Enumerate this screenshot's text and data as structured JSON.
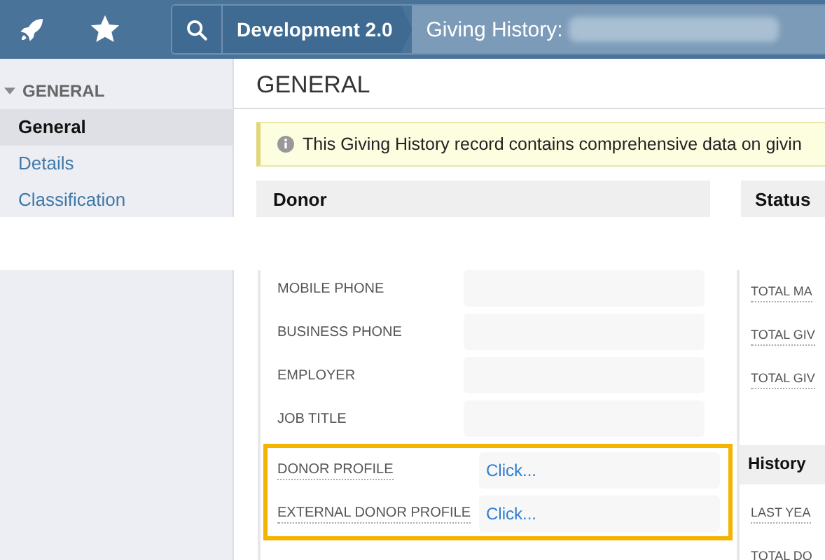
{
  "top_bar": {
    "breadcrumbs": [
      {
        "label": "Development 2.0"
      },
      {
        "label": "Giving History:",
        "redacted_suffix": true
      }
    ]
  },
  "sidebar": {
    "section": {
      "label": "GENERAL",
      "expanded": true
    },
    "items": [
      {
        "label": "General",
        "selected": true
      },
      {
        "label": "Details",
        "selected": false
      },
      {
        "label": "Classification",
        "selected": false
      }
    ]
  },
  "page_title": "GENERAL",
  "info_banner": "This Giving History record contains comprehensive data on givin",
  "donor": {
    "title": "Donor",
    "fields": [
      {
        "label": "MOBILE PHONE",
        "help": false
      },
      {
        "label": "BUSINESS PHONE",
        "help": false
      },
      {
        "label": "EMPLOYER",
        "help": false
      },
      {
        "label": "JOB TITLE",
        "help": false
      }
    ],
    "highlighted_fields": [
      {
        "label": "DONOR PROFILE",
        "help": true,
        "value": "Click..."
      },
      {
        "label": "EXTERNAL DONOR PROFILE",
        "help": true,
        "value": "Click..."
      }
    ]
  },
  "status": {
    "title": "Status",
    "fields": [
      {
        "label": "TOTAL MA"
      },
      {
        "label": "TOTAL GIV"
      },
      {
        "label": "TOTAL GIV"
      }
    ]
  },
  "history": {
    "title": "History",
    "fields": [
      {
        "label": "LAST YEA"
      },
      {
        "label": "TOTAL DO"
      }
    ]
  }
}
